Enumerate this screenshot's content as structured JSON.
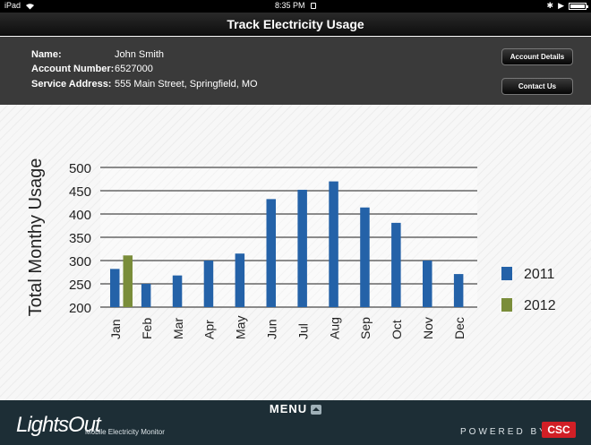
{
  "status_bar": {
    "device": "iPad",
    "time": "8:35 PM"
  },
  "title": "Track Electricity Usage",
  "account": {
    "name_label": "Name:",
    "name_value": "John Smith",
    "number_label": "Account Number:",
    "number_value": "6527000",
    "address_label": "Service Address:",
    "address_value": "555 Main Street, Springfield, MO",
    "details_button": "Account Details",
    "contact_button": "Contact Us"
  },
  "chart_data": {
    "type": "bar",
    "ylabel": "Total Monthy Usage",
    "ylim": [
      200,
      500
    ],
    "yticks": [
      200,
      250,
      300,
      350,
      400,
      450,
      500
    ],
    "categories": [
      "Jan",
      "Feb",
      "Mar",
      "Apr",
      "May",
      "Jun",
      "Jul",
      "Aug",
      "Sep",
      "Oct",
      "Nov",
      "Dec"
    ],
    "series": [
      {
        "name": "2011",
        "color": "#2462a8",
        "values": [
          282,
          250,
          268,
          300,
          315,
          432,
          452,
          470,
          414,
          381,
          300,
          271
        ]
      },
      {
        "name": "2012",
        "color": "#7a8d3a",
        "values": [
          311,
          null,
          null,
          null,
          null,
          null,
          null,
          null,
          null,
          null,
          null,
          null
        ]
      }
    ],
    "legend_position": "right",
    "grid": true
  },
  "footer": {
    "menu_label": "MENU",
    "logo_text": "LightsOut",
    "tagline": "Mobile Electricity Monitor",
    "powered_by": "POWERED BY",
    "brand": "CSC"
  }
}
